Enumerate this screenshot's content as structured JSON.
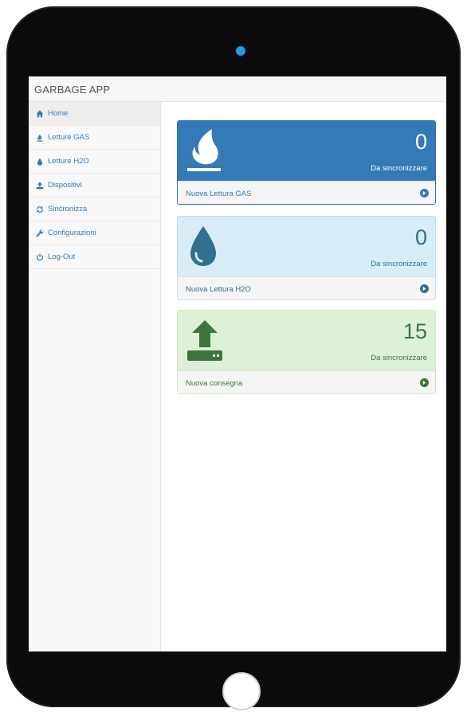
{
  "app": {
    "brand": "GARBAGE APP"
  },
  "sidebar": {
    "items": [
      {
        "label": "Home",
        "icon": "home-icon"
      },
      {
        "label": "Letture GAS",
        "icon": "fire-icon"
      },
      {
        "label": "Letture H2O",
        "icon": "tint-icon"
      },
      {
        "label": "Dispositivi",
        "icon": "upload-icon"
      },
      {
        "label": "Sincronizza",
        "icon": "refresh-icon"
      },
      {
        "label": "Configurazioni",
        "icon": "wrench-icon"
      },
      {
        "label": "Log-Out",
        "icon": "power-icon"
      }
    ]
  },
  "panels": {
    "gas": {
      "count": "0",
      "subtitle": "Da sincronizzare",
      "link": "Nuova Lettura GAS",
      "icon": "gas-flame-icon",
      "color": "#337ab7"
    },
    "h2o": {
      "count": "0",
      "subtitle": "Da sincronizzare",
      "link": "Nuova Lettura H2O",
      "icon": "water-drop-icon",
      "color": "#31708f"
    },
    "consegna": {
      "count": "15",
      "subtitle": "Da sincronizzare",
      "link": "Nuova consegna",
      "icon": "upload-device-icon",
      "color": "#3c763d"
    }
  },
  "device": {
    "camera_color": "#1f9be6",
    "bezel_color": "#0b0b0b"
  }
}
